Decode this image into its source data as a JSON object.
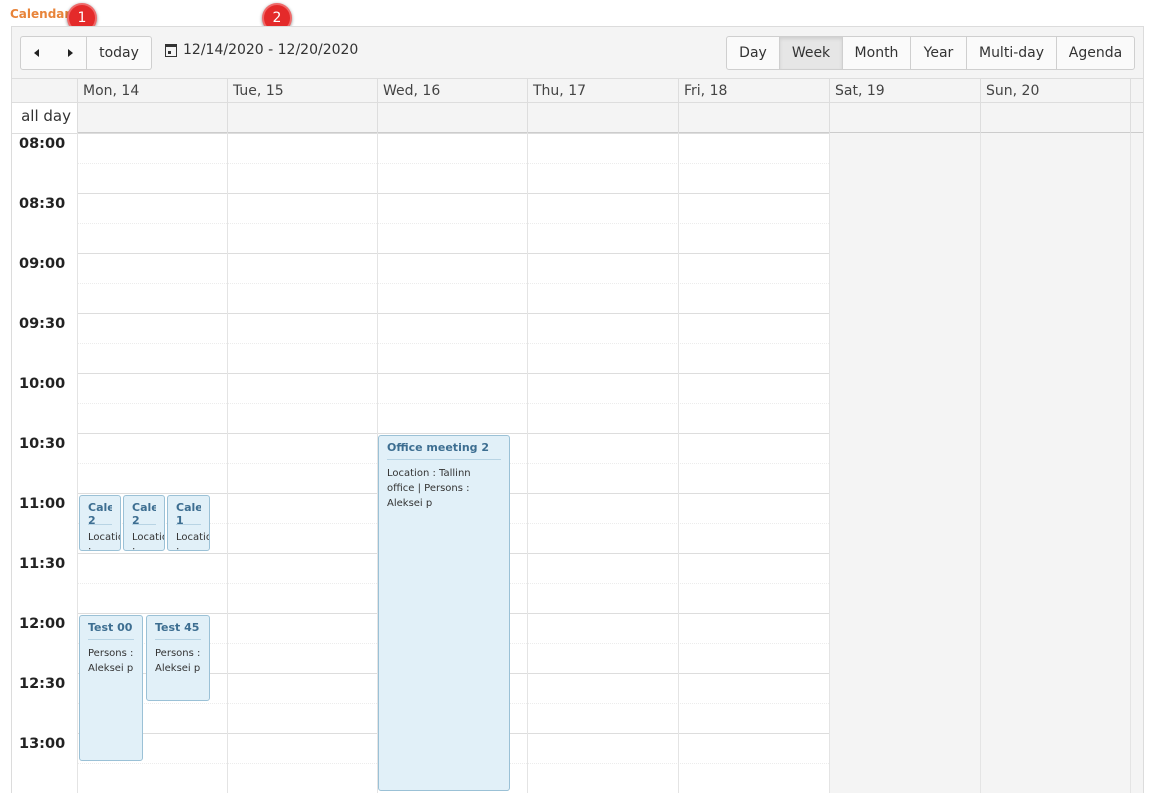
{
  "page_title": "Calendar",
  "badges": [
    "1",
    "2"
  ],
  "toolbar": {
    "prev_icon": "triangle-left-icon",
    "next_icon": "triangle-right-icon",
    "today_label": "today",
    "date_range": "12/14/2020 - 12/20/2020",
    "views": [
      "Day",
      "Week",
      "Month",
      "Year",
      "Multi-day",
      "Agenda"
    ],
    "active_view": "Week"
  },
  "days": [
    "Mon, 14",
    "Tue, 15",
    "Wed, 16",
    "Thu, 17",
    "Fri, 18",
    "Sat, 19",
    "Sun, 20"
  ],
  "allday_label": "all day",
  "times": [
    "08:00",
    "08:30",
    "09:00",
    "09:30",
    "10:00",
    "10:30",
    "11:00",
    "11:30",
    "12:00",
    "12:30",
    "13:00"
  ],
  "events": [
    {
      "title": "Office meeting 2",
      "body": "Location : Tallinn office | Persons : Aleksei p"
    },
    {
      "title": "Cale 2",
      "body": "Location :"
    },
    {
      "title": "Cale 2",
      "body": "Location :"
    },
    {
      "title": "Cale 1",
      "body": "Location :"
    },
    {
      "title": "Test 00",
      "body": "Persons : Aleksei p"
    },
    {
      "title": "Test 45",
      "body": "Persons : Aleksei p"
    }
  ],
  "colors": {
    "accent": "#e8843a",
    "badge": "#e42a2a",
    "event_bg": "#e1f0f8",
    "event_title": "#3d6e91",
    "weekend_bg": "#f4f4f4"
  }
}
